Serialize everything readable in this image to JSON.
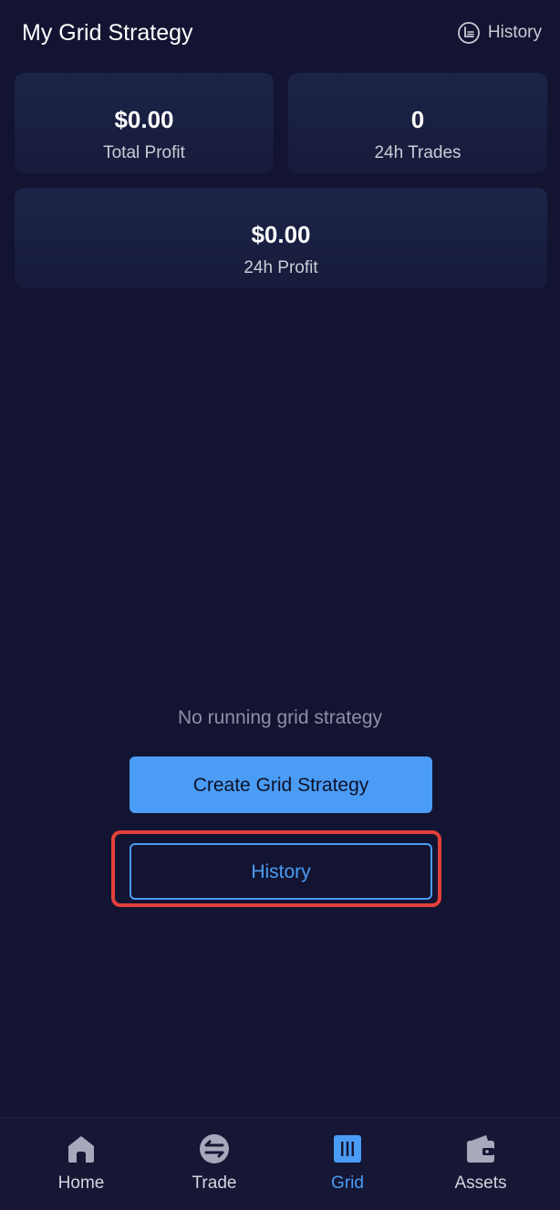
{
  "header": {
    "title": "My Grid Strategy",
    "history_label": "History"
  },
  "stats": {
    "total_profit": {
      "value": "$0.00",
      "label": "Total Profit"
    },
    "trades_24h": {
      "value": "0",
      "label": "24h Trades"
    },
    "profit_24h": {
      "value": "$0.00",
      "label": "24h Profit"
    }
  },
  "empty_state": {
    "message": "No running grid strategy",
    "create_label": "Create Grid Strategy",
    "history_label": "History"
  },
  "bottom_nav": {
    "items": [
      {
        "label": "Home",
        "icon": "home-icon",
        "active": false
      },
      {
        "label": "Trade",
        "icon": "trade-icon",
        "active": false
      },
      {
        "label": "Grid",
        "icon": "grid-icon",
        "active": true
      },
      {
        "label": "Assets",
        "icon": "wallet-icon",
        "active": false
      }
    ]
  },
  "colors": {
    "background": "#131431",
    "accent": "#4a9cf5",
    "highlight": "#e2403a"
  }
}
